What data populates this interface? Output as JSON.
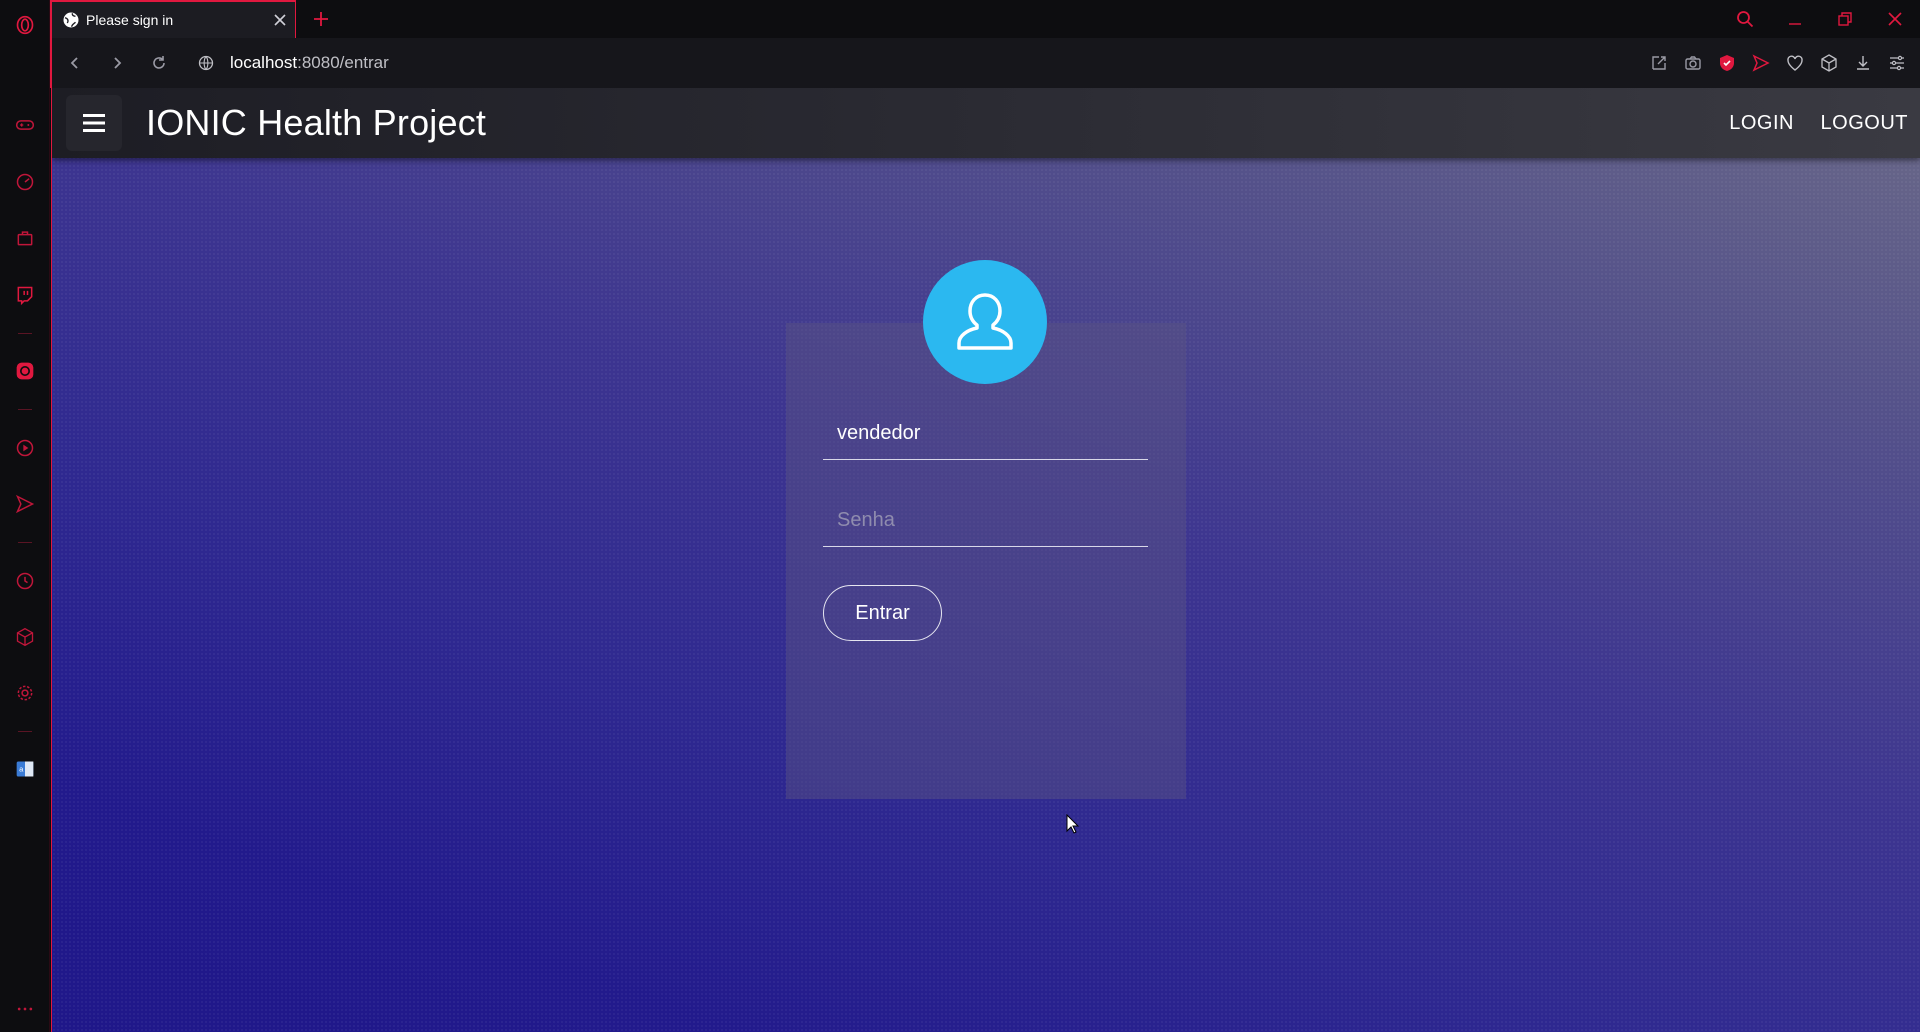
{
  "browser": {
    "tab_title": "Please sign in",
    "url_host": "localhost",
    "url_rest": ":8080/entrar"
  },
  "app": {
    "title": "IONIC Health Project",
    "nav": {
      "login": "LOGIN",
      "logout": "LOGOUT"
    }
  },
  "login_form": {
    "username_value": "vendedor",
    "password_placeholder": "Senha",
    "submit_label": "Entrar"
  },
  "colors": {
    "browser_accent": "#e0183f",
    "avatar_bg": "#2bb8f0"
  }
}
